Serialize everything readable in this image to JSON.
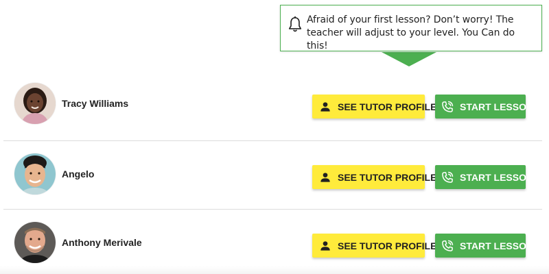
{
  "tooltip": {
    "text": "Afraid of your first lesson? Don’t worry! The teacher will adjust to your level. You Can do this!",
    "icon": "bell-icon",
    "border_color": "#4caf50"
  },
  "buttons": {
    "profile_label": "SEE TUTOR PROFILE",
    "profile_icon": "person-icon",
    "profile_color": "#ffeb3b",
    "start_label": "START LESSON",
    "start_icon": "phone-call-icon",
    "start_color": "#4caf50"
  },
  "tutors": [
    {
      "name": "Tracy Williams",
      "avatar": "avatar-photo"
    },
    {
      "name": "Angelo",
      "avatar": "avatar-photo"
    },
    {
      "name": "Anthony Merivale",
      "avatar": "avatar-photo"
    }
  ]
}
